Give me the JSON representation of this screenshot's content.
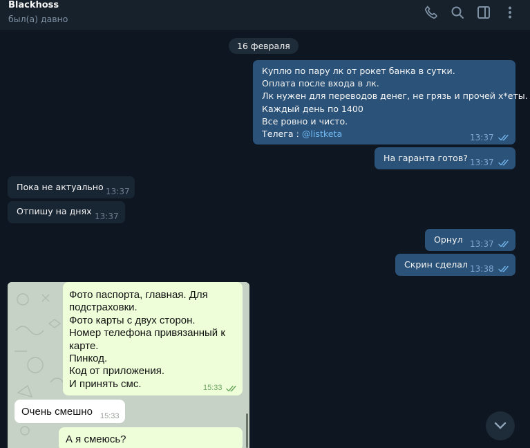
{
  "header": {
    "name": "Blackhoss",
    "status": "был(а) давно",
    "icons": [
      "phone-icon",
      "search-icon",
      "sidebar-toggle-icon",
      "more-vertical-icon"
    ]
  },
  "chat": {
    "date_chip": "16 февраля",
    "messages": [
      {
        "dir": "out",
        "lines": [
          "Куплю по пару лк от рокет банка в сутки.",
          "Оплата после входа в лк.",
          "Лк нужен для переводов денег, не грязь и прочей х*еты.",
          "Каждый день по 1400",
          "Все ровно и чисто.",
          "Телега : "
        ],
        "link": "@listketa",
        "time": "13:37"
      },
      {
        "dir": "out",
        "text": "На гаранта готов?",
        "time": "13:37"
      },
      {
        "dir": "in",
        "text": "Пока не актуально",
        "time": "13:37"
      },
      {
        "dir": "in",
        "text": "Отпишу на днях",
        "time": "13:37"
      },
      {
        "dir": "out",
        "text": "Орнул",
        "time": "13:37"
      },
      {
        "dir": "out",
        "text": "Скрин сделал",
        "time": "13:38"
      }
    ],
    "photo": {
      "bubbles": [
        {
          "kind": "out",
          "text": "Фото паспорта, главная. Для\nподстраховки.\nФото карты с двух сторон.\nНомер телефона привязанный к\nкарте.\nПинкод.\nКод от приложения.\nИ принять смс.",
          "time": "15:33"
        },
        {
          "kind": "in",
          "text": "Очень смешно",
          "time": "15:33"
        },
        {
          "kind": "out",
          "text": "А я смеюсь?",
          "time": ""
        }
      ]
    }
  },
  "colors": {
    "background": "#0e1621",
    "header": "#17212b",
    "bubble_out": "#2b5278",
    "bubble_in": "#182533",
    "link": "#71baf5",
    "photo_bubble_out": "#eefed9"
  }
}
